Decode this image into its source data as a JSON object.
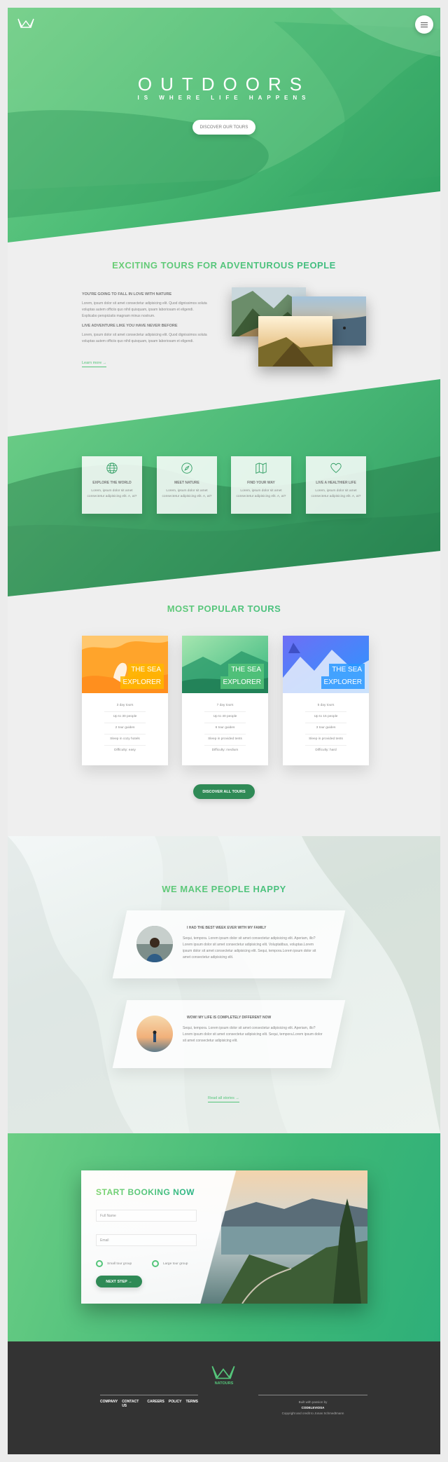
{
  "header": {
    "title": "OUTDOORS",
    "subtitle": "IS WHERE LIFE HAPPENS",
    "cta": "DISCOVER OUR TOURS"
  },
  "about": {
    "title": "EXCITING TOURS FOR ADVENTUROUS PEOPLE",
    "h1": "YOU'RE GOING TO FALL IN LOVE WITH NATURE",
    "p1": "Lorem, ipsum dolor sit amet consectetur adipisicing elit. Quod dignissimos soluta voluptas autem officiis quo nihil quisquam, ipsam laboriosam et eligendi. Explicabo perspiciatis magnam minus nostrum.",
    "h2": "LIVE ADVENTURE LIKE YOU HAVE NEVER BEFORE",
    "p2": "Lorem, ipsum dolor sit amet consectetur adipisicing elit. Quod dignissimos soluta voluptas autem officiis quo nihil quisquam, ipsam laboriosam et eligendi.",
    "link": "Learn more →"
  },
  "features": [
    {
      "title": "EXPLORE THE WORLD",
      "text": "Lorem, ipsum dolor sit amet consectetur adipisicing elit. A, at?",
      "icon": "globe-icon"
    },
    {
      "title": "MEET NATURE",
      "text": "Lorem, ipsum dolor sit amet consectetur adipisicing elit. A, at?",
      "icon": "compass-icon"
    },
    {
      "title": "FIND YOUR WAY",
      "text": "Lorem, ipsum dolor sit amet consectetur adipisicing elit. A, at?",
      "icon": "map-icon"
    },
    {
      "title": "LIVE A HEALTHIER LIFE",
      "text": "Lorem, ipsum dolor sit amet consectetur adipisicing elit. A, at?",
      "icon": "heart-icon"
    }
  ],
  "tours": {
    "title": "MOST POPULAR TOURS",
    "cards": [
      {
        "title1": "THE SEA",
        "title2": "EXPLORER",
        "color": "#ffb900",
        "items": [
          "3 day tours",
          "Up to 30 people",
          "2 tour guides",
          "Sleep in cozy hotels",
          "Difficulty: easy"
        ]
      },
      {
        "title1": "THE SEA",
        "title2": "EXPLORER",
        "color": "#7ed56f",
        "items": [
          "7 day tours",
          "Up to 40 people",
          "6 tour guides",
          "Sleep in provided tents",
          "Difficulty: medium"
        ]
      },
      {
        "title1": "THE SEA",
        "title2": "EXPLORER",
        "color": "#2998ff",
        "items": [
          "5 day tours",
          "Up to 15 people",
          "3 tour guides",
          "Sleep in provided tents",
          "Difficulty: hard"
        ]
      }
    ],
    "button": "DISCOVER ALL TOURS"
  },
  "stories": {
    "title": "WE MAKE PEOPLE HAPPY",
    "items": [
      {
        "heading": "I HAD THE BEST WEEK EVER WITH MY FAMILY",
        "text": "Sequi, tempora. Lorem ipsum dolor sit amet consectetur adipisicing elit. Aperiam, illo? Lorem ipsum dolor sit amet consectetur adipisicing elit. Voluptatibus, voluptas.Lorem ipsum dolor sit amet consectetur adipisicing elit. Sequi, tempora.Lorem ipsum dolor sit amet consectetur adipisicing elit."
      },
      {
        "heading": "WOW! MY LIFE IS COMPLETELY DIFFERENT NOW",
        "text": "Sequi, tempora. Lorem ipsum dolor sit amet consectetur adipisicing elit. Aperiam, illo? Lorem ipsum dolor sit amet consectetur adipisicing elit. Sequi, tempora.Lorem ipsum dolor sit amet consectetur adipisicing elit."
      }
    ],
    "link": "Read all stories →"
  },
  "booking": {
    "title": "START BOOKING NOW",
    "name_placeholder": "Full Name",
    "email_placeholder": "Email",
    "radio1": "Small tour group",
    "radio2": "Large tour group",
    "button": "NEXT STEP →"
  },
  "footer": {
    "brand": "NATOURS",
    "nav": [
      "COMPANY",
      "CONTACT US",
      "CAREERS",
      "POLICY",
      "TERMS"
    ],
    "copy1": "Built with passion by",
    "copy2": "CODELEVIOSA",
    "copy3": "Copyright and credit to Jonas Schmedtmann"
  }
}
